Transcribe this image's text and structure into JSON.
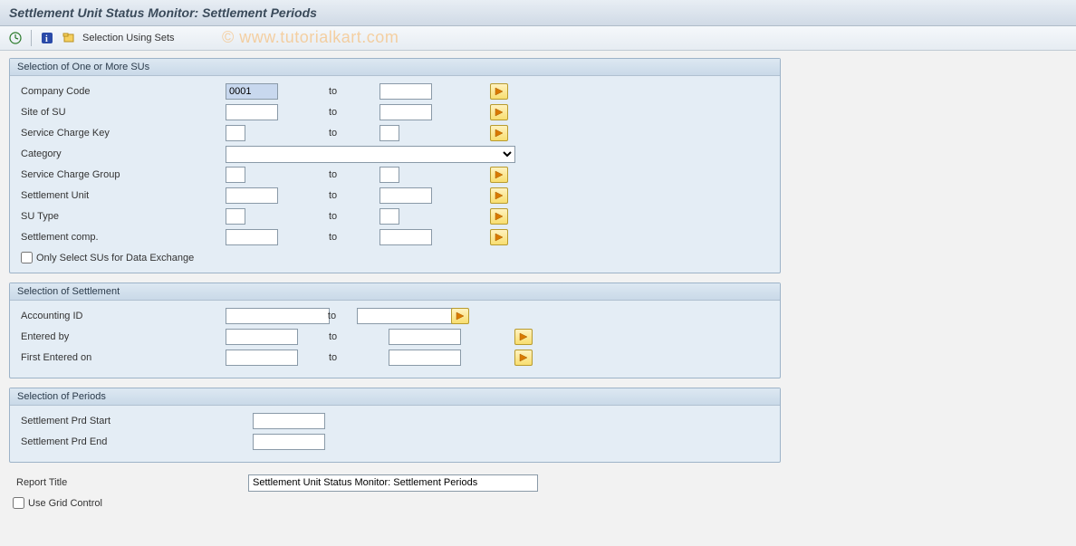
{
  "title": "Settlement Unit Status Monitor: Settlement Periods",
  "toolbar": {
    "selection_using_sets": "Selection Using Sets"
  },
  "watermark": "© www.tutorialkart.com",
  "group1": {
    "header": "Selection of One or More SUs",
    "rows": {
      "company_code": {
        "label": "Company Code",
        "from": "0001",
        "to_label": "to",
        "to": ""
      },
      "site_of_su": {
        "label": "Site of SU",
        "from": "",
        "to_label": "to",
        "to": ""
      },
      "service_key": {
        "label": "Service Charge Key",
        "from": "",
        "to_label": "to",
        "to": ""
      },
      "category": {
        "label": "Category",
        "value": ""
      },
      "service_group": {
        "label": "Service Charge Group",
        "from": "",
        "to_label": "to",
        "to": ""
      },
      "settlement_unit": {
        "label": "Settlement Unit",
        "from": "",
        "to_label": "to",
        "to": ""
      },
      "su_type": {
        "label": "SU Type",
        "from": "",
        "to_label": "to",
        "to": ""
      },
      "settlement_comp": {
        "label": "Settlement comp.",
        "from": "",
        "to_label": "to",
        "to": ""
      }
    },
    "only_select": "Only Select SUs for Data Exchange"
  },
  "group2": {
    "header": "Selection of Settlement",
    "rows": {
      "accounting_id": {
        "label": "Accounting ID",
        "from": "",
        "to_label": "to",
        "to": ""
      },
      "entered_by": {
        "label": "Entered by",
        "from": "",
        "to_label": "to",
        "to": ""
      },
      "first_entered": {
        "label": "First Entered on",
        "from": "",
        "to_label": "to",
        "to": ""
      }
    }
  },
  "group3": {
    "header": "Selection of Periods",
    "rows": {
      "prd_start": {
        "label": "Settlement Prd Start",
        "value": ""
      },
      "prd_end": {
        "label": "Settlement Prd End",
        "value": ""
      }
    }
  },
  "report_title_label": "Report Title",
  "report_title_value": "Settlement Unit Status Monitor: Settlement Periods",
  "use_grid_control": "Use Grid Control"
}
